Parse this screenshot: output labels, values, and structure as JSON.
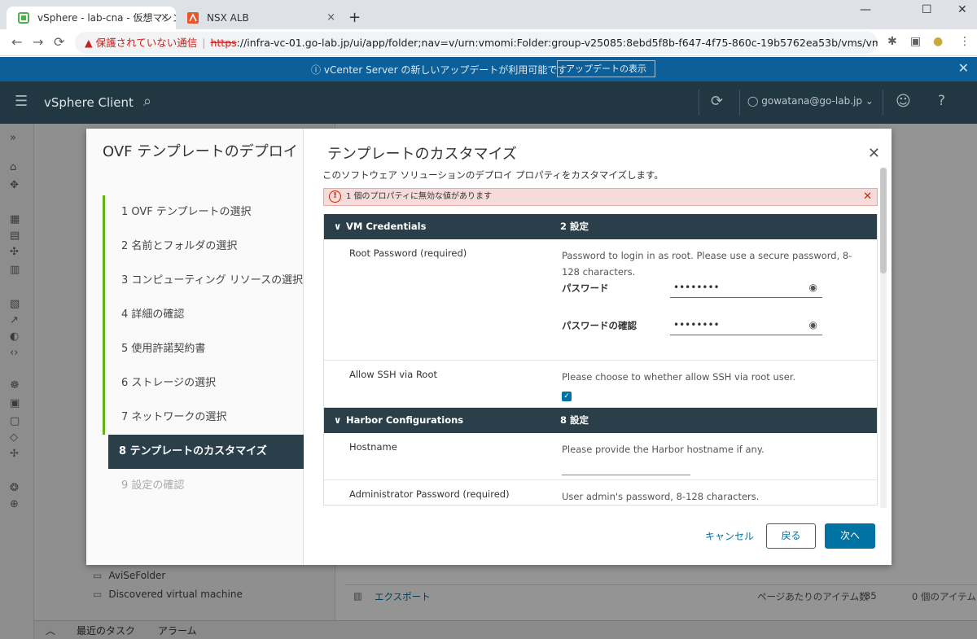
{
  "browser": {
    "tabs": [
      {
        "title": "vSphere - lab-cna - 仮想マシン フォ",
        "close": "×"
      },
      {
        "title": "NSX ALB",
        "close": "×"
      }
    ],
    "new_tab": "+",
    "window_controls": {
      "minimize": "—",
      "maximize": "☐",
      "close": "✕"
    },
    "nav": {
      "back": "←",
      "forward": "→",
      "reload": "⟳"
    },
    "url": {
      "warning_icon": "▲",
      "warning": "保護されていない通信",
      "scheme": "https",
      "rest": "://infra-vc-01.go-lab.jp/ui/app/folder;nav=v/urn:vmomi:Folder:group-v25085:8ebd5f8b-f647-4f75-860c-19b5762ea53b/vms/vm-folders"
    },
    "toolbar_icons": {
      "translate": "⇆",
      "share": "⇪",
      "bookmark": "☆",
      "extensions": "✱",
      "sidebar": "▣",
      "profile": "●",
      "menu": "⋮"
    }
  },
  "notice": {
    "icon": "ⓘ",
    "message": "vCenter Server の新しいアップデートが利用可能です",
    "button": "アップデートの表示",
    "close": "✕"
  },
  "app": {
    "menu_icon": "☰",
    "brand": "vSphere Client",
    "search_icon": "⌕",
    "refresh_icon": "⟳",
    "user": "gowatana@go-lab.jp ⌄",
    "user_icon": "◯",
    "smile_icon": "☺",
    "help_icon": "?"
  },
  "nav_tree": {
    "folders": [
      "AviSeFolder",
      "Discovered virtual machine"
    ],
    "folder_icon": "▭"
  },
  "content": {
    "export": "エクスポート",
    "per_page_label": "ページあたりのアイテム数",
    "per_page_value": "35",
    "item_count": "0 個のアイテム"
  },
  "taskbar": {
    "recent_tasks": "最近のタスク",
    "alarms": "アラーム",
    "chevron": "︿"
  },
  "dialog": {
    "title": "OVF テンプレートのデプロイ",
    "steps": [
      {
        "label": "1  OVF テンプレートの選択",
        "state": "done"
      },
      {
        "label": "2  名前とフォルダの選択",
        "state": "done"
      },
      {
        "label": "3  コンピューティング リソースの選択",
        "state": "done"
      },
      {
        "label": "4  詳細の確認",
        "state": "done"
      },
      {
        "label": "5  使用許諾契約書",
        "state": "done"
      },
      {
        "label": "6  ストレージの選択",
        "state": "done"
      },
      {
        "label": "7  ネットワークの選択",
        "state": "done"
      },
      {
        "label": "8  テンプレートのカスタマイズ",
        "state": "active"
      },
      {
        "label": "9  設定の確認",
        "state": "pending"
      }
    ],
    "main_title": "テンプレートのカスタマイズ",
    "close": "✕",
    "subtitle": "このソフトウェア ソリューションのデプロイ プロパティをカスタマイズします。",
    "alert": {
      "icon": "!",
      "text": "1 個のプロパティに無効な値があります",
      "close": "✕"
    },
    "sections": [
      {
        "chevron": "∨",
        "name": "VM Credentials",
        "count": "2 設定",
        "rows": [
          {
            "label": "Root Password (required)",
            "desc": "Password to login in as root. Please use a secure password, 8-128 characters.",
            "password_label": "パスワード",
            "password_value": "••••••••",
            "confirm_label": "パスワードの確認",
            "confirm_value": "••••••••",
            "eye_icon": "◉"
          },
          {
            "label": "Allow SSH via Root",
            "desc": "Please choose to whether allow SSH via root user.",
            "checked": true,
            "check_mark": "✓"
          }
        ]
      },
      {
        "chevron": "∨",
        "name": "Harbor Configurations",
        "count": "8 設定",
        "rows": [
          {
            "label": "Hostname",
            "desc": "Please provide the Harbor hostname if any.",
            "value": ""
          },
          {
            "label": "Administrator Password (required)",
            "desc": "User admin's password, 8-128 characters."
          }
        ]
      }
    ],
    "buttons": {
      "cancel": "キャンセル",
      "back": "戻る",
      "next": "次へ"
    }
  }
}
